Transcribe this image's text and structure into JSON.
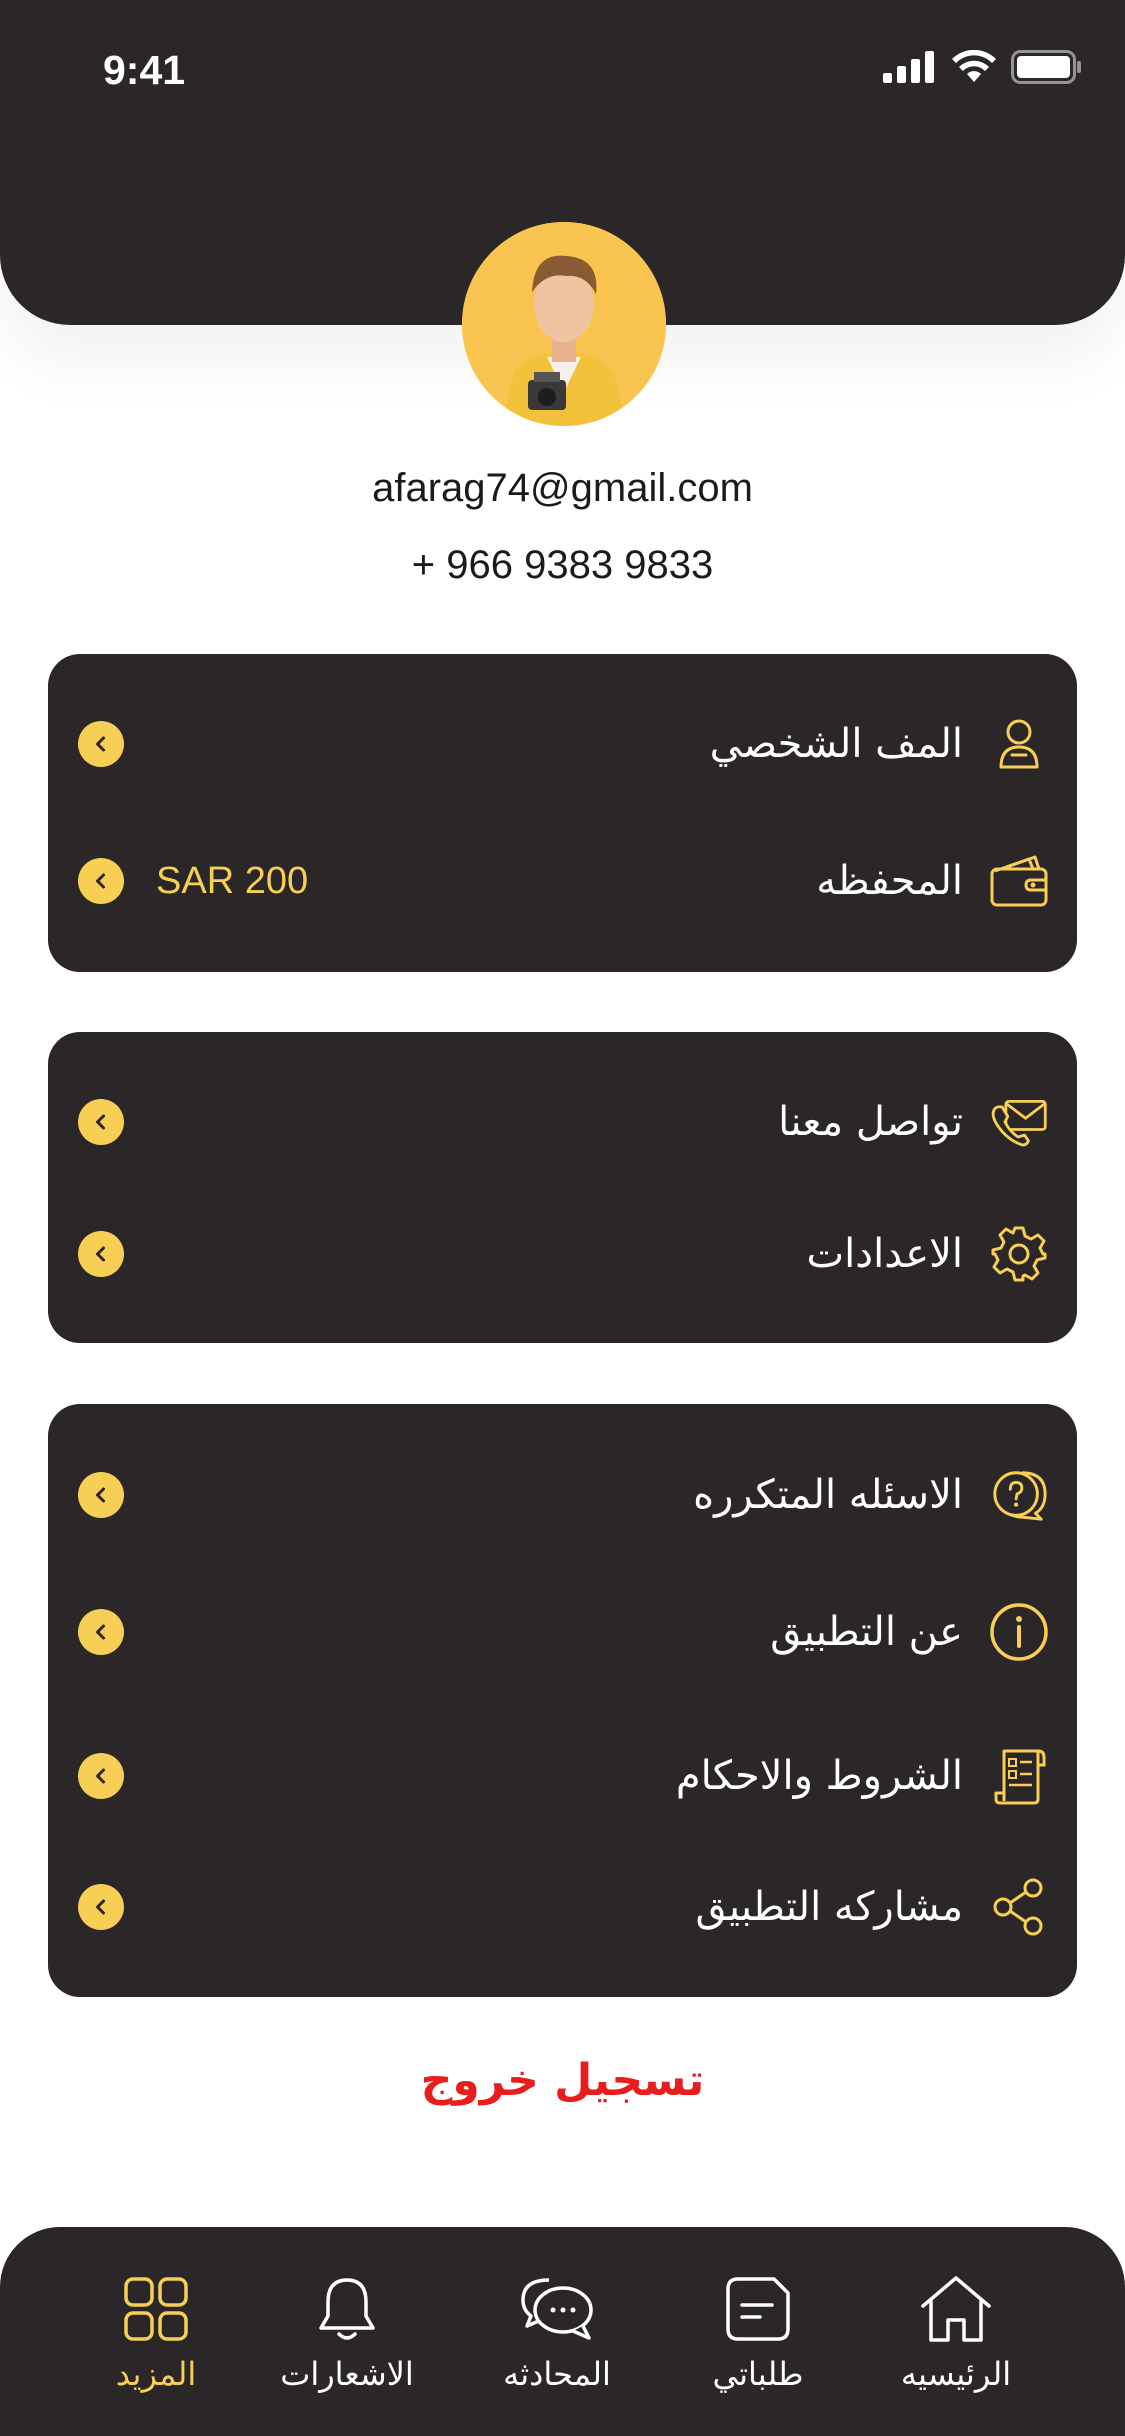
{
  "status_bar": {
    "time": "9:41"
  },
  "profile": {
    "email": "afarag74@gmail.com",
    "phone": "+ 966 9383 9833"
  },
  "groups": [
    {
      "items": [
        {
          "label": "المف الشخصي",
          "icon": "user-icon",
          "value": ""
        },
        {
          "label": "المحفظه",
          "icon": "wallet-icon",
          "value": "SAR 200"
        }
      ]
    },
    {
      "items": [
        {
          "label": "تواصل معنا",
          "icon": "contact-icon"
        },
        {
          "label": "الاعدادات",
          "icon": "gear-icon"
        }
      ]
    },
    {
      "items": [
        {
          "label": "الاسئله المتكرره",
          "icon": "faq-icon"
        },
        {
          "label": "عن التطبيق",
          "icon": "info-icon"
        },
        {
          "label": "الشروط والاحكام",
          "icon": "terms-icon"
        },
        {
          "label": "مشاركه التطبيق",
          "icon": "share-icon"
        }
      ]
    }
  ],
  "logout_label": "تسجيل خروج",
  "tabbar": [
    {
      "label": "الرئيسيه",
      "icon": "home-icon",
      "active": false
    },
    {
      "label": "طلباتي",
      "icon": "orders-icon",
      "active": false
    },
    {
      "label": "المحادثه",
      "icon": "chat-icon",
      "active": false
    },
    {
      "label": "الاشعارات",
      "icon": "bell-icon",
      "active": false
    },
    {
      "label": "المزيد",
      "icon": "grid-icon",
      "active": true
    }
  ],
  "colors": {
    "dark": "#2b2627",
    "accent": "#f8cf55",
    "logout": "#ea1d1d"
  }
}
